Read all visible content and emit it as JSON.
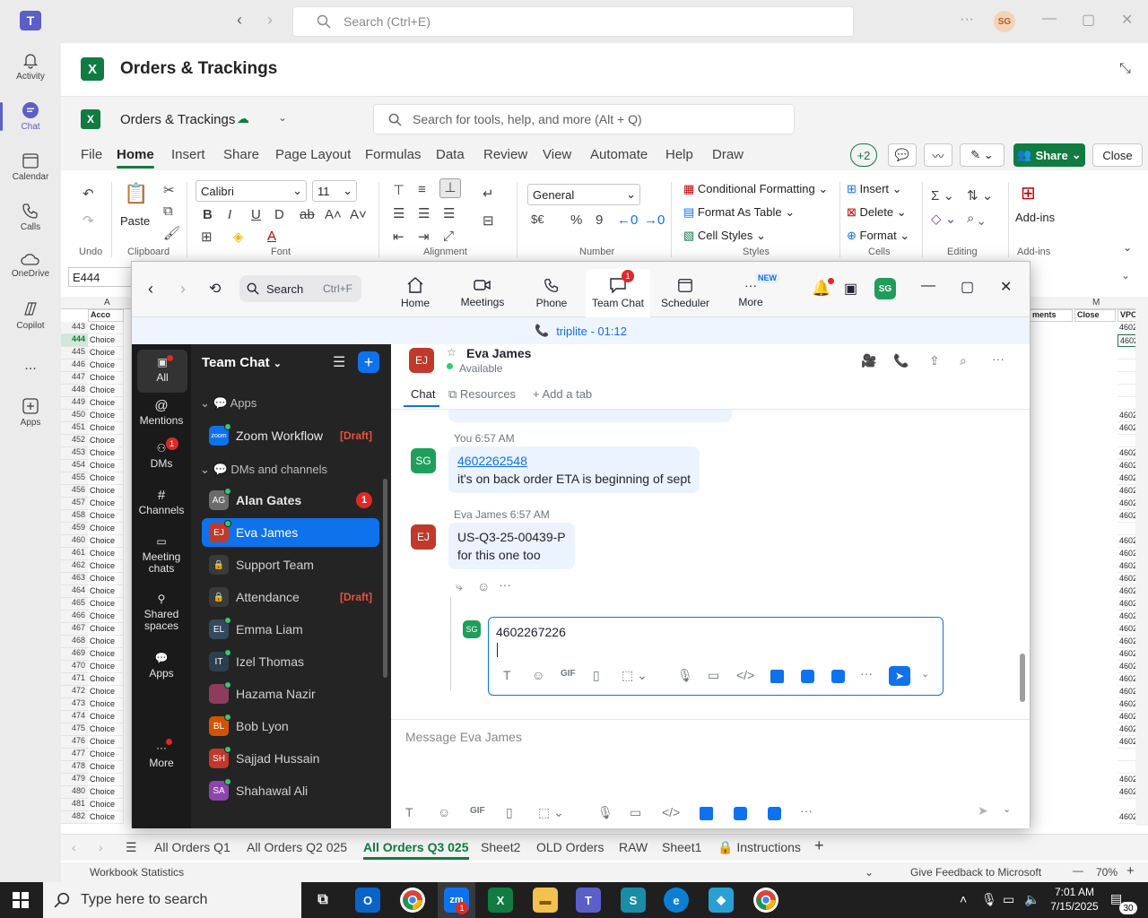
{
  "teams": {
    "search_placeholder": "Search (Ctrl+E)",
    "user_initials": "SG",
    "rail": [
      {
        "label": "Activity",
        "icon": "bell-icon"
      },
      {
        "label": "Chat",
        "icon": "chat-icon"
      },
      {
        "label": "Calendar",
        "icon": "calendar-icon"
      },
      {
        "label": "Calls",
        "icon": "phone-icon"
      },
      {
        "label": "OneDrive",
        "icon": "cloud-icon"
      },
      {
        "label": "Copilot",
        "icon": "copilot-icon"
      },
      {
        "label": "...",
        "icon": "more-icon"
      },
      {
        "label": "Apps",
        "icon": "apps-icon"
      }
    ]
  },
  "excel": {
    "title": "Orders & Trackings",
    "doc_name": "Orders & Trackings",
    "search_placeholder": "Search for tools, help, and more (Alt + Q)",
    "menu_tabs": [
      "File",
      "Home",
      "Insert",
      "Share",
      "Page Layout",
      "Formulas",
      "Data",
      "Review",
      "View",
      "Automate",
      "Help",
      "Draw"
    ],
    "collab_count": "+2",
    "share_label": "Share",
    "close_label": "Close",
    "ribbon": {
      "undo_label": "Undo",
      "clipboard_label": "Clipboard",
      "paste_label": "Paste",
      "font_label": "Font",
      "font_name": "Calibri",
      "font_size": "11",
      "alignment_label": "Alignment",
      "number_label": "Number",
      "number_format": "General",
      "currency_symbol": "$€",
      "styles_label": "Styles",
      "cond_format": "Conditional Formatting",
      "format_table": "Format As Table",
      "cell_styles": "Cell Styles",
      "cells_label": "Cells",
      "insert": "Insert",
      "delete": "Delete",
      "format": "Format",
      "editing_label": "Editing",
      "addins": "Add-ins",
      "addins_label": "Add-ins"
    },
    "name_box": "E444",
    "columns": {
      "a": "A",
      "first_header": "Acco",
      "m": "M",
      "c1": "ments",
      "c2": "Close",
      "c3": "VPO"
    },
    "rows": [
      {
        "num": "443",
        "a": "Choice",
        "v": "4602"
      },
      {
        "num": "444",
        "a": "Choice",
        "v": "4602"
      },
      {
        "num": "445",
        "a": "Choice",
        "v": ""
      },
      {
        "num": "446",
        "a": "Choice",
        "v": ""
      },
      {
        "num": "447",
        "a": "Choice",
        "v": ""
      },
      {
        "num": "448",
        "a": "Choice",
        "v": ""
      },
      {
        "num": "449",
        "a": "Choice",
        "v": ""
      },
      {
        "num": "450",
        "a": "Choice",
        "v": "4602"
      },
      {
        "num": "451",
        "a": "Choice",
        "v": "4602"
      },
      {
        "num": "452",
        "a": "Choice",
        "v": ""
      },
      {
        "num": "453",
        "a": "Choice",
        "v": "4602"
      },
      {
        "num": "454",
        "a": "Choice",
        "v": "4602"
      },
      {
        "num": "455",
        "a": "Choice",
        "v": "4602"
      },
      {
        "num": "456",
        "a": "Choice",
        "v": "4602"
      },
      {
        "num": "457",
        "a": "Choice",
        "v": "4602"
      },
      {
        "num": "458",
        "a": "Choice",
        "v": "4602"
      },
      {
        "num": "459",
        "a": "Choice",
        "v": ""
      },
      {
        "num": "460",
        "a": "Choice",
        "v": "4602"
      },
      {
        "num": "461",
        "a": "Choice",
        "v": "4602"
      },
      {
        "num": "462",
        "a": "Choice",
        "v": "4602"
      },
      {
        "num": "463",
        "a": "Choice",
        "v": "4602"
      },
      {
        "num": "464",
        "a": "Choice",
        "v": "4602"
      },
      {
        "num": "465",
        "a": "Choice",
        "v": "4602"
      },
      {
        "num": "466",
        "a": "Choice",
        "v": "4602"
      },
      {
        "num": "467",
        "a": "Choice",
        "v": "4602"
      },
      {
        "num": "468",
        "a": "Choice",
        "v": "4602"
      },
      {
        "num": "469",
        "a": "Choice",
        "v": "4602"
      },
      {
        "num": "470",
        "a": "Choice",
        "v": "4602"
      },
      {
        "num": "471",
        "a": "Choice",
        "v": "4602"
      },
      {
        "num": "472",
        "a": "Choice",
        "v": "4602"
      },
      {
        "num": "473",
        "a": "Choice",
        "v": "4602"
      },
      {
        "num": "474",
        "a": "Choice",
        "v": "4602"
      },
      {
        "num": "475",
        "a": "Choice",
        "v": "4602"
      },
      {
        "num": "476",
        "a": "Choice",
        "v": "4602"
      },
      {
        "num": "477",
        "a": "Choice",
        "v": ""
      },
      {
        "num": "478",
        "a": "Choice",
        "v": ""
      },
      {
        "num": "479",
        "a": "Choice",
        "v": "4602"
      },
      {
        "num": "480",
        "a": "Choice",
        "v": "4602"
      },
      {
        "num": "481",
        "a": "Choice",
        "v": ""
      },
      {
        "num": "482",
        "a": "Choice",
        "v": "4602"
      }
    ],
    "sheet_tabs": [
      "All Orders Q1",
      "All Orders Q2 025",
      "All Orders Q3 025",
      "Sheet2",
      "OLD Orders",
      "RAW",
      "Sheet1",
      "Instructions"
    ],
    "active_sheet": "All Orders Q3 025",
    "status_left": "Workbook Statistics",
    "status_feedback": "Give Feedback to Microsoft",
    "zoom_level": "70%"
  },
  "zoom": {
    "search_label": "Search",
    "search_shortcut": "Ctrl+F",
    "nav": [
      {
        "label": "Home",
        "icon": "home-icon"
      },
      {
        "label": "Meetings",
        "icon": "video-icon"
      },
      {
        "label": "Phone",
        "icon": "phone-icon"
      },
      {
        "label": "Team Chat",
        "icon": "team-chat-icon",
        "badge": "1"
      },
      {
        "label": "Scheduler",
        "icon": "scheduler-icon"
      },
      {
        "label": "More",
        "icon": "more-icon",
        "badge": "NEW"
      }
    ],
    "avatar_initials": "SG",
    "call_banner": "triplite - 01:12",
    "left_nav": [
      {
        "label": "All"
      },
      {
        "label": "Mentions"
      },
      {
        "label": "DMs",
        "badge": "1"
      },
      {
        "label": "Channels"
      },
      {
        "label": "Meeting chats"
      },
      {
        "label": "Shared spaces"
      },
      {
        "label": "Apps"
      },
      {
        "label": "More"
      }
    ],
    "sidebar_title": "Team Chat",
    "apps_section": "Apps",
    "apps": [
      {
        "name": "Zoom Workflow",
        "tag": "[Draft]"
      }
    ],
    "dms_section": "DMs and channels",
    "contacts": [
      {
        "initials": "AG",
        "name": "Alan Gates",
        "color": "#6b6b6b",
        "badge": "1",
        "bold": true
      },
      {
        "initials": "EJ",
        "name": "Eva James",
        "color": "#c0392b",
        "active": true
      },
      {
        "initials": "",
        "name": "Support Team",
        "color": "#3a3a3a",
        "lock": true
      },
      {
        "initials": "",
        "name": "Attendance",
        "color": "#3a3a3a",
        "lock": true,
        "tag": "[Draft]"
      },
      {
        "initials": "EL",
        "name": "Emma Liam",
        "color": "#34495e"
      },
      {
        "initials": "IT",
        "name": "Izel Thomas",
        "color": "#2c3e50"
      },
      {
        "initials": "",
        "name": "Hazama Nazir",
        "color": "#8e3b5e"
      },
      {
        "initials": "BL",
        "name": "Bob Lyon",
        "color": "#d35400"
      },
      {
        "initials": "SH",
        "name": "Sajjad Hussain",
        "color": "#c0392b"
      },
      {
        "initials": "SA",
        "name": "Shahawal Ali",
        "color": "#8e44ad"
      }
    ],
    "chat": {
      "contact_initials": "EJ",
      "contact_name": "Eva James",
      "status": "Available",
      "tabs": [
        "Chat",
        "Resources",
        "Add a tab"
      ],
      "messages": [
        {
          "author": "You",
          "time": "6:57 AM",
          "initials": "SG",
          "link": "4602262548",
          "text": "it's on back order ETA is beginning of sept"
        },
        {
          "author": "Eva James",
          "time": "6:57 AM",
          "initials": "EJ",
          "line1": "US-Q3-25-00439-P",
          "line2": "for this one too"
        }
      ],
      "reply_initials": "SG",
      "reply_text": "4602267226",
      "composer_placeholder": "Message Eva James"
    }
  },
  "taskbar": {
    "search_placeholder": "Type here to search",
    "time": "7:01 AM",
    "date": "7/15/2025",
    "notification_count": "30",
    "zoom_badge": "1"
  },
  "colors": {
    "excel_green": "#107c41",
    "zoom_blue": "#0e72ed",
    "teams_purple": "#5b5fc7",
    "badge_red": "#e02828"
  }
}
